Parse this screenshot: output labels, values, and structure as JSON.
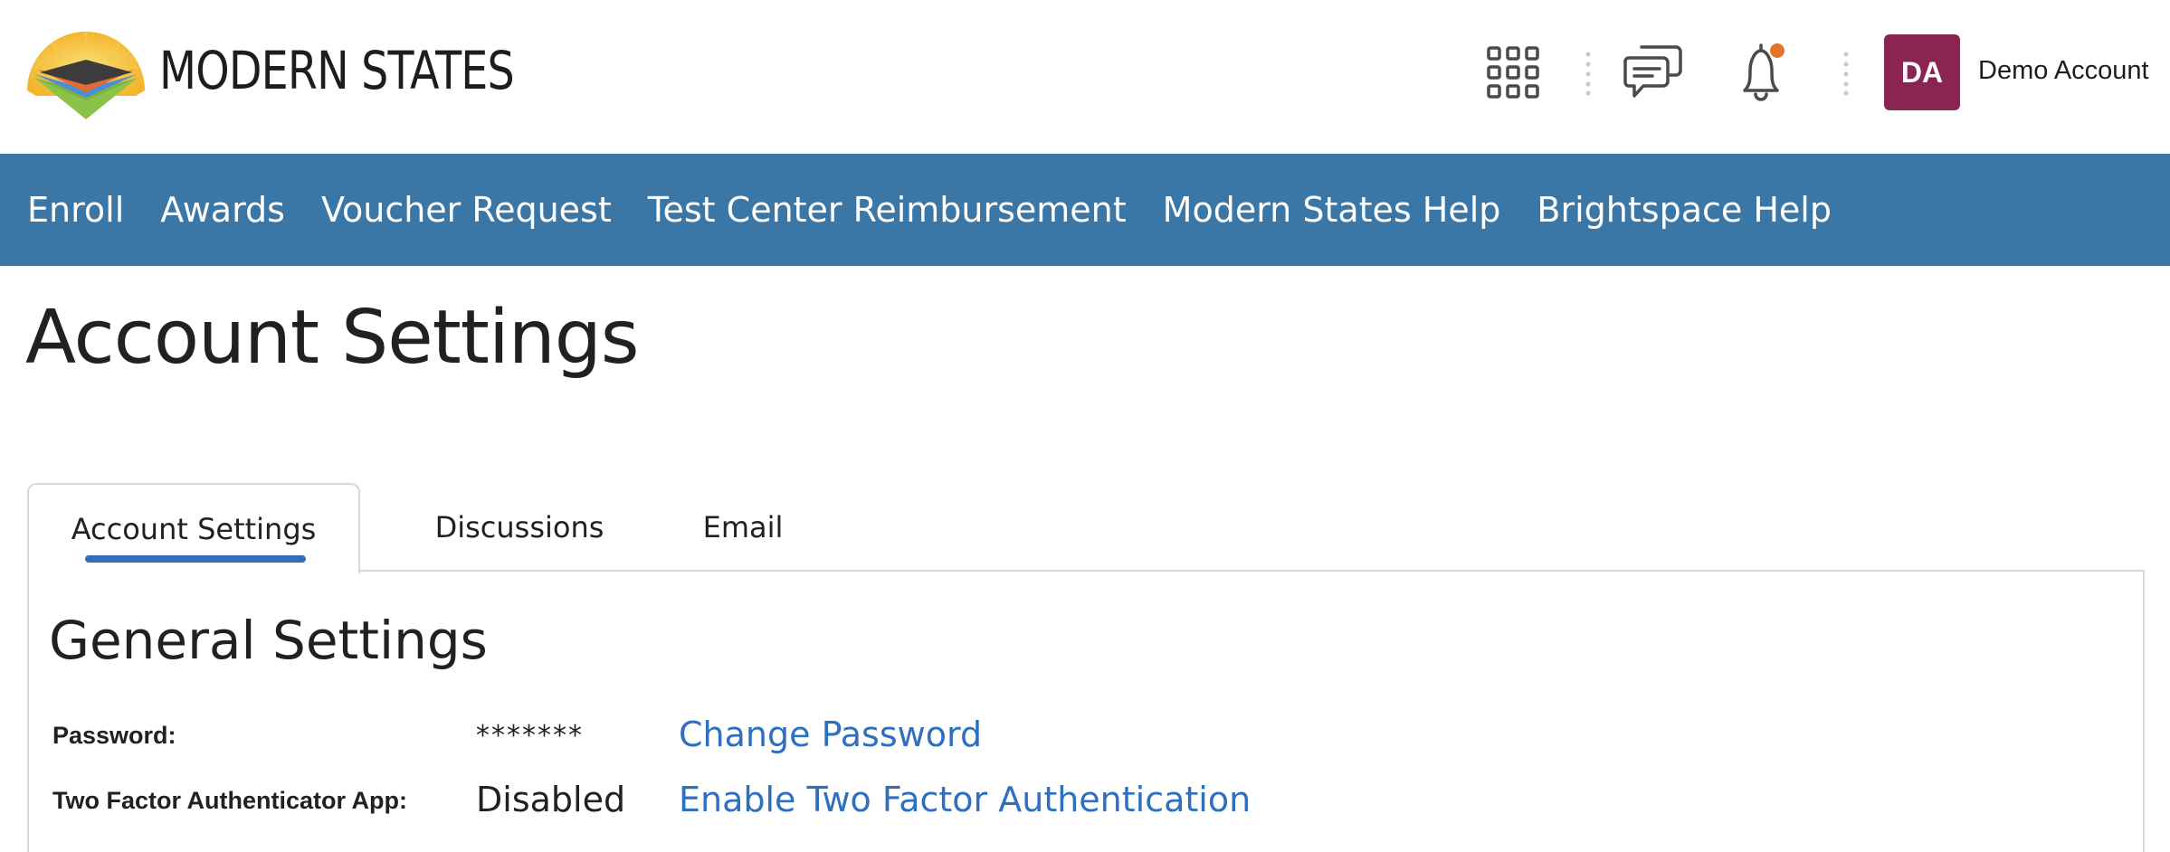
{
  "header": {
    "logo_text": "MODERN STATES",
    "apps_icon": "apps-grid-icon",
    "chat_icon": "chat-bubbles-icon",
    "bell_icon": "notification-bell-icon",
    "notification_dot_color": "#e5742b",
    "user": {
      "initials": "DA",
      "name": "Demo Account",
      "avatar_color": "#8b2452"
    }
  },
  "nav": {
    "background": "#3a77a6",
    "items": [
      {
        "label": "Enroll"
      },
      {
        "label": "Awards"
      },
      {
        "label": "Voucher Request"
      },
      {
        "label": "Test Center Reimbursement"
      },
      {
        "label": "Modern States Help"
      },
      {
        "label": "Brightspace Help"
      }
    ]
  },
  "page": {
    "title": "Account Settings"
  },
  "tabs": {
    "items": [
      {
        "label": "Account Settings",
        "selected": true
      },
      {
        "label": "Discussions",
        "selected": false
      },
      {
        "label": "Email",
        "selected": false
      }
    ],
    "accent": "#2f6fbf"
  },
  "general": {
    "title": "General Settings",
    "rows": [
      {
        "label": "Password:",
        "value": "*******",
        "action": "Change Password"
      },
      {
        "label": "Two Factor Authenticator App:",
        "value": "Disabled",
        "action": "Enable Two Factor Authentication"
      }
    ]
  }
}
